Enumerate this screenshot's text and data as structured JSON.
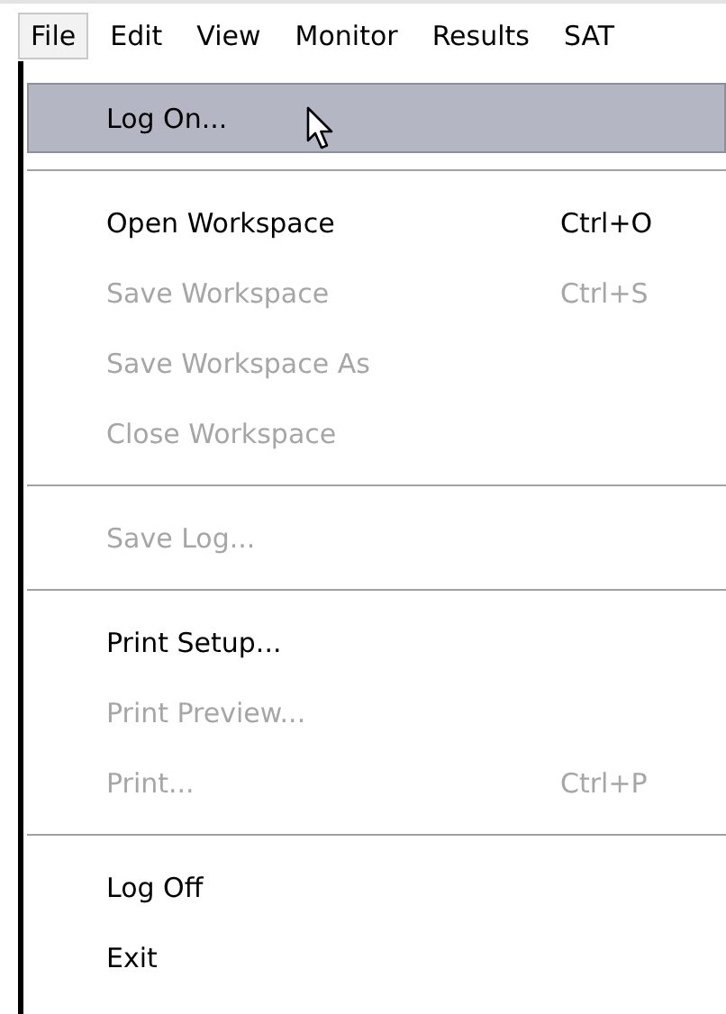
{
  "menu_bar": [
    {
      "label": "File",
      "selected": true
    },
    {
      "label": "Edit",
      "selected": false
    },
    {
      "label": "View",
      "selected": false
    },
    {
      "label": "Monitor",
      "selected": false
    },
    {
      "label": "Results",
      "selected": false
    },
    {
      "label": "SAT",
      "selected": false
    }
  ],
  "file_menu": [
    {
      "kind": "item",
      "label": "Log On...",
      "disabled": false,
      "selected": true
    },
    {
      "kind": "separator"
    },
    {
      "kind": "item",
      "label": "Open Workspace",
      "shortcut": "Ctrl+O",
      "disabled": false,
      "selected": false
    },
    {
      "kind": "item",
      "label": "Save Workspace",
      "shortcut": "Ctrl+S",
      "disabled": true,
      "selected": false
    },
    {
      "kind": "item",
      "label": "Save Workspace As",
      "disabled": true,
      "selected": false
    },
    {
      "kind": "item",
      "label": "Close Workspace",
      "disabled": true,
      "selected": false
    },
    {
      "kind": "separator"
    },
    {
      "kind": "item",
      "label": "Save Log...",
      "disabled": true,
      "selected": false
    },
    {
      "kind": "separator"
    },
    {
      "kind": "item",
      "label": "Print Setup...",
      "disabled": false,
      "selected": false
    },
    {
      "kind": "item",
      "label": "Print Preview...",
      "disabled": true,
      "selected": false
    },
    {
      "kind": "item",
      "label": "Print...",
      "shortcut": "Ctrl+P",
      "disabled": true,
      "selected": false
    },
    {
      "kind": "separator"
    },
    {
      "kind": "item",
      "label": "Log Off",
      "disabled": false,
      "selected": false
    },
    {
      "kind": "item",
      "label": "Exit",
      "disabled": false,
      "selected": false
    }
  ]
}
